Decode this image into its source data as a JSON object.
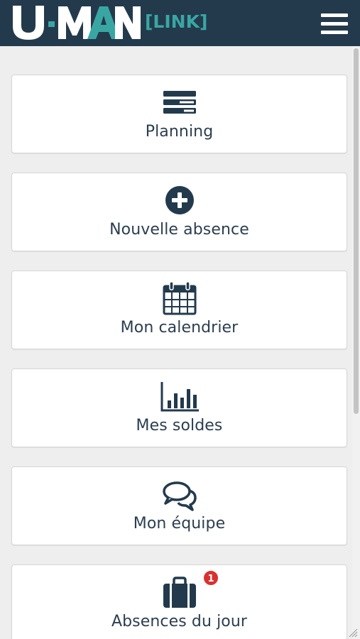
{
  "header": {
    "logo_text": "U-MAN",
    "logo_suffix": "[LINK]",
    "menu_icon": "hamburger-menu-icon",
    "bg_color": "#233a4c",
    "accent_color": "#3aa6a4"
  },
  "tiles": [
    {
      "label": "Planning",
      "icon": "server-stack-icon"
    },
    {
      "label": "Nouvelle absence",
      "icon": "plus-circle-icon"
    },
    {
      "label": "Mon calendrier",
      "icon": "calendar-icon"
    },
    {
      "label": "Mes soldes",
      "icon": "bar-chart-icon"
    },
    {
      "label": "Mon équipe",
      "icon": "chat-bubbles-icon"
    },
    {
      "label": "Absences du jour",
      "icon": "briefcase-icon",
      "badge": "1"
    }
  ],
  "colors": {
    "icon": "#233a4c",
    "text": "#2c3e4f",
    "badge": "#d9312f",
    "background": "#eeeeee"
  }
}
